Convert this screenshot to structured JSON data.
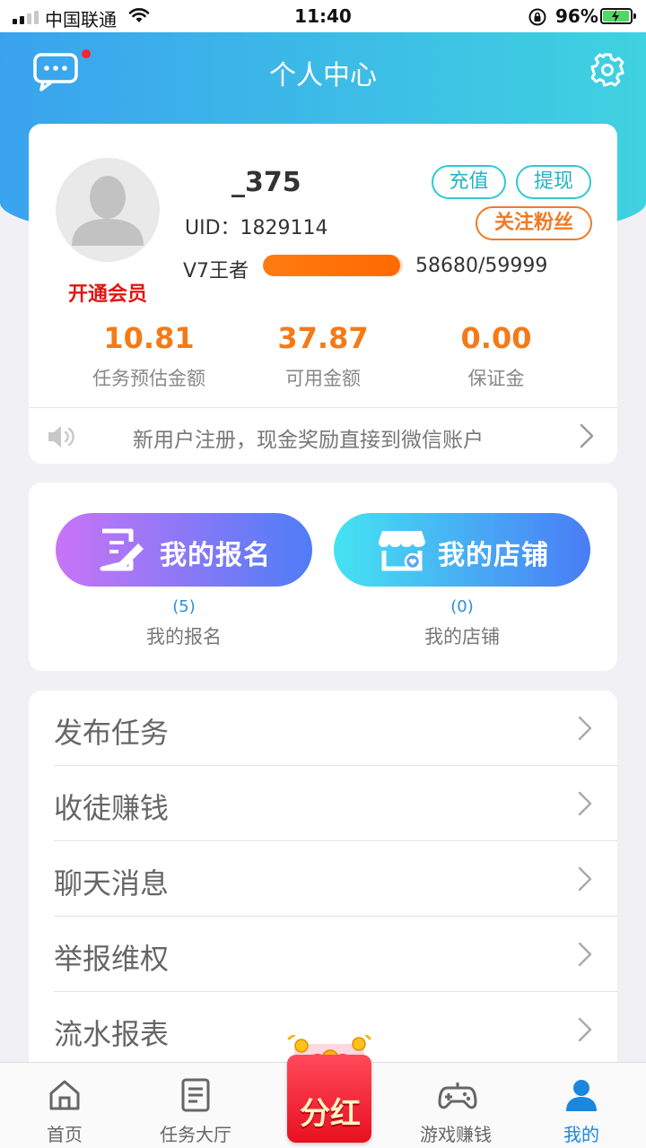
{
  "status_bar": {
    "carrier": "中国联通",
    "time": "11:40",
    "battery": "96%",
    "battery_level": 0.96
  },
  "header": {
    "title": "个人中心",
    "message_icon": "chat-bubble-icon",
    "settings_icon": "gear-icon"
  },
  "profile": {
    "username": "_375",
    "uid": "UID：1829114",
    "vip_label": "开通会员",
    "recharge_label": "充值",
    "withdraw_label": "提现",
    "follow_label": "关注粉丝",
    "level_name": "V7王者",
    "level_progress_text": "58680/59999",
    "level_progress_fraction": 0.978
  },
  "stats": [
    {
      "value": "10.81",
      "label": "任务预估金额"
    },
    {
      "value": "37.87",
      "label": "可用金额"
    },
    {
      "value": "0.00",
      "label": "保证金"
    }
  ],
  "notice": {
    "text": "新用户注册，现金奖励直接到微信账户",
    "icon": "speaker-icon"
  },
  "quick_actions": [
    {
      "button_label": "我的报名",
      "count": "(5)",
      "label": "我的报名",
      "icon": "form-edit-icon"
    },
    {
      "button_label": "我的店铺",
      "count": "(0)",
      "label": "我的店铺",
      "icon": "shop-icon"
    }
  ],
  "menu": [
    {
      "label": "发布任务"
    },
    {
      "label": "收徒赚钱"
    },
    {
      "label": "聊天消息"
    },
    {
      "label": "举报维权"
    },
    {
      "label": "流水报表"
    }
  ],
  "tabbar": {
    "home": "首页",
    "tasks": "任务大厅",
    "bonus": "分红",
    "games": "游戏赚钱",
    "mine": "我的"
  },
  "colors": {
    "header_gradient_start": "#3aa3ee",
    "header_gradient_end": "#3fd2e0",
    "accent_orange": "#f47a18",
    "active_tab": "#1a87de",
    "vip_red": "#e31414"
  }
}
